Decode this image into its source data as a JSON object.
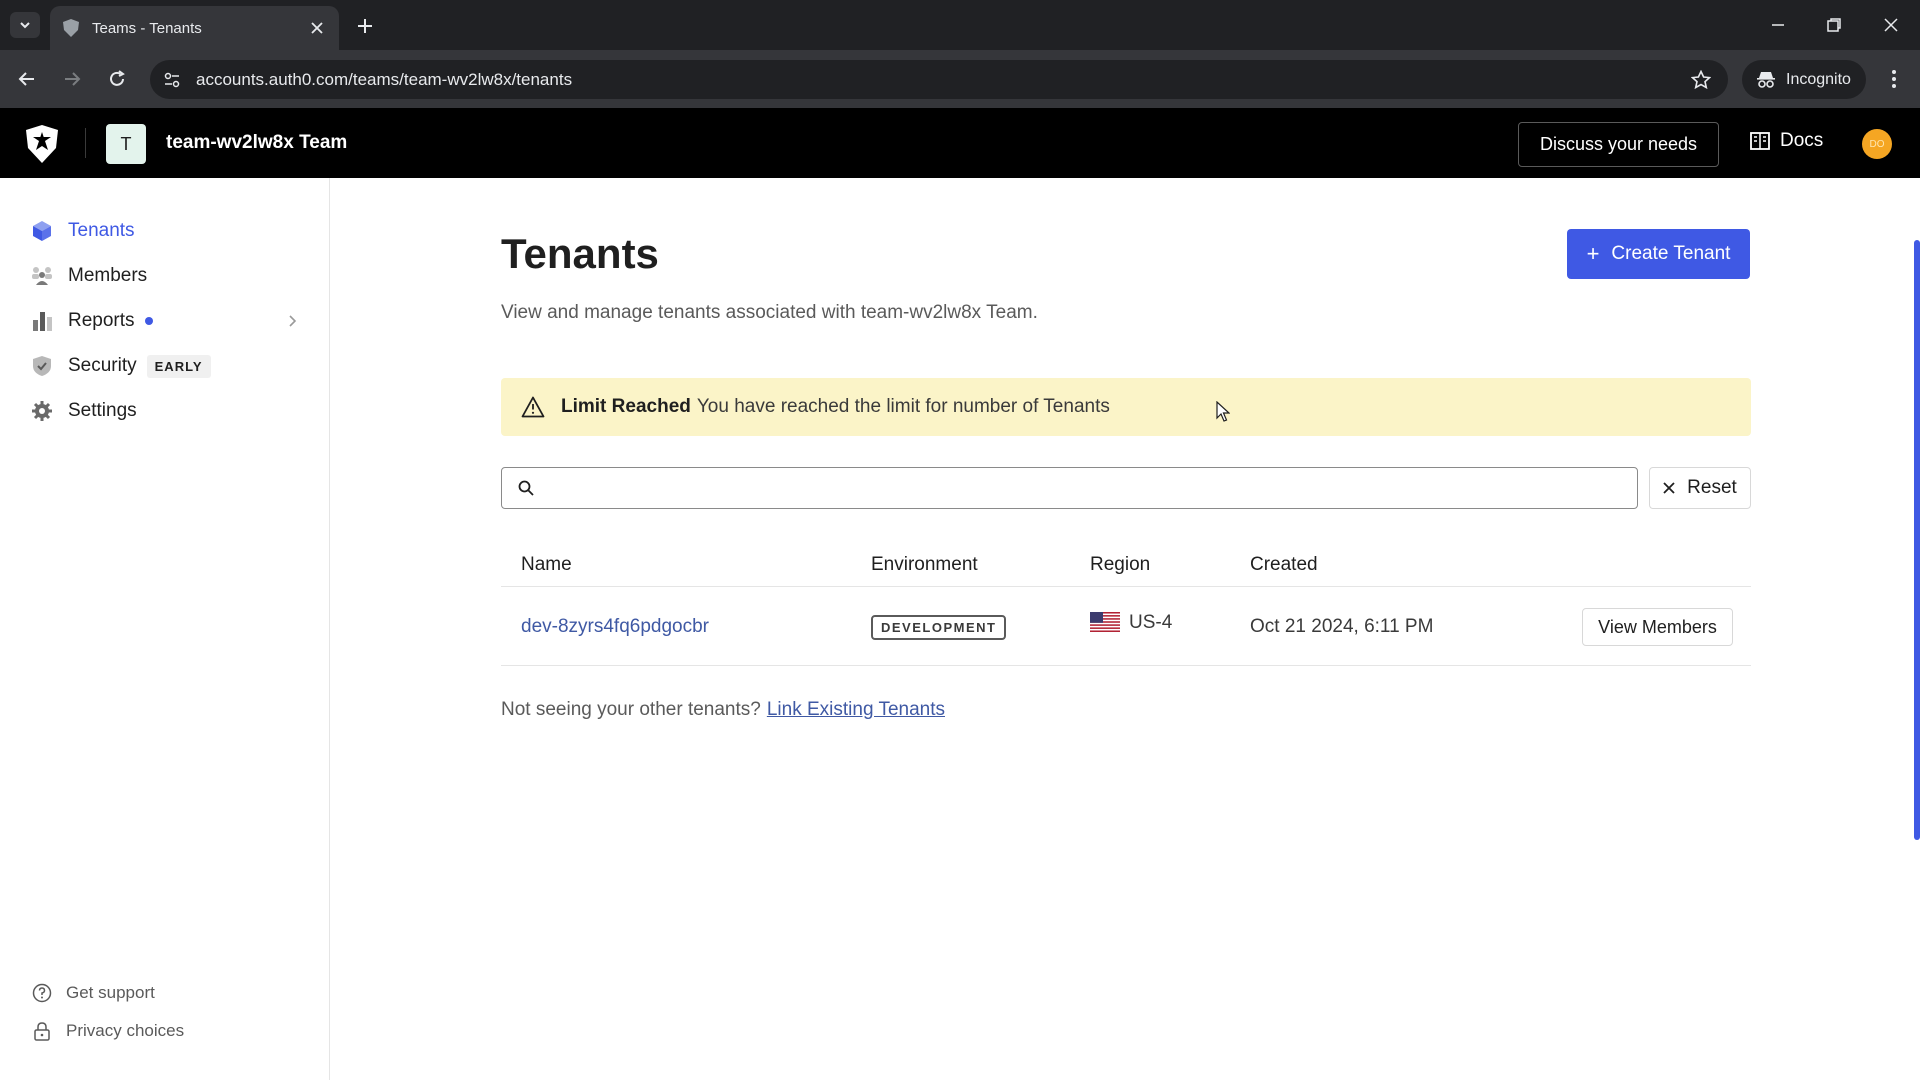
{
  "browser": {
    "tab_title": "Teams - Tenants",
    "url": "accounts.auth0.com/teams/team-wv2lw8x/tenants",
    "incognito_label": "Incognito"
  },
  "header": {
    "team_initial": "T",
    "team_name": "team-wv2lw8x Team",
    "discuss_label": "Discuss your needs",
    "docs_label": "Docs",
    "user_initials": "DO"
  },
  "sidebar": {
    "items": [
      {
        "label": "Tenants",
        "icon": "cube-icon",
        "active": true
      },
      {
        "label": "Members",
        "icon": "members-icon"
      },
      {
        "label": "Reports",
        "icon": "bar-chart-icon"
      },
      {
        "label": "Security",
        "icon": "shield-check-icon",
        "badge": "EARLY"
      },
      {
        "label": "Settings",
        "icon": "gear-icon"
      }
    ],
    "footer": [
      {
        "label": "Get support",
        "icon": "help-circle-icon"
      },
      {
        "label": "Privacy choices",
        "icon": "lock-icon"
      }
    ]
  },
  "main": {
    "title": "Tenants",
    "description": "View and manage tenants associated with team-wv2lw8x Team.",
    "create_label": "Create Tenant",
    "alert": {
      "title": "Limit Reached",
      "message": "You have reached the limit for number of Tenants"
    },
    "search_placeholder": "",
    "reset_label": "Reset",
    "table": {
      "columns": [
        "Name",
        "Environment",
        "Region",
        "Created"
      ],
      "rows": [
        {
          "name": "dev-8zyrs4fq6pdgocbr",
          "environment": "DEVELOPMENT",
          "region": "US-4",
          "created": "Oct 21 2024, 6:11 PM",
          "action": "View Members"
        }
      ]
    },
    "not_seeing_text": "Not seeing your other tenants?",
    "link_existing_label": "Link Existing Tenants"
  },
  "colors": {
    "accent": "#3f59e4",
    "alert_bg": "#fbf4c8",
    "header_bg": "#000000"
  }
}
